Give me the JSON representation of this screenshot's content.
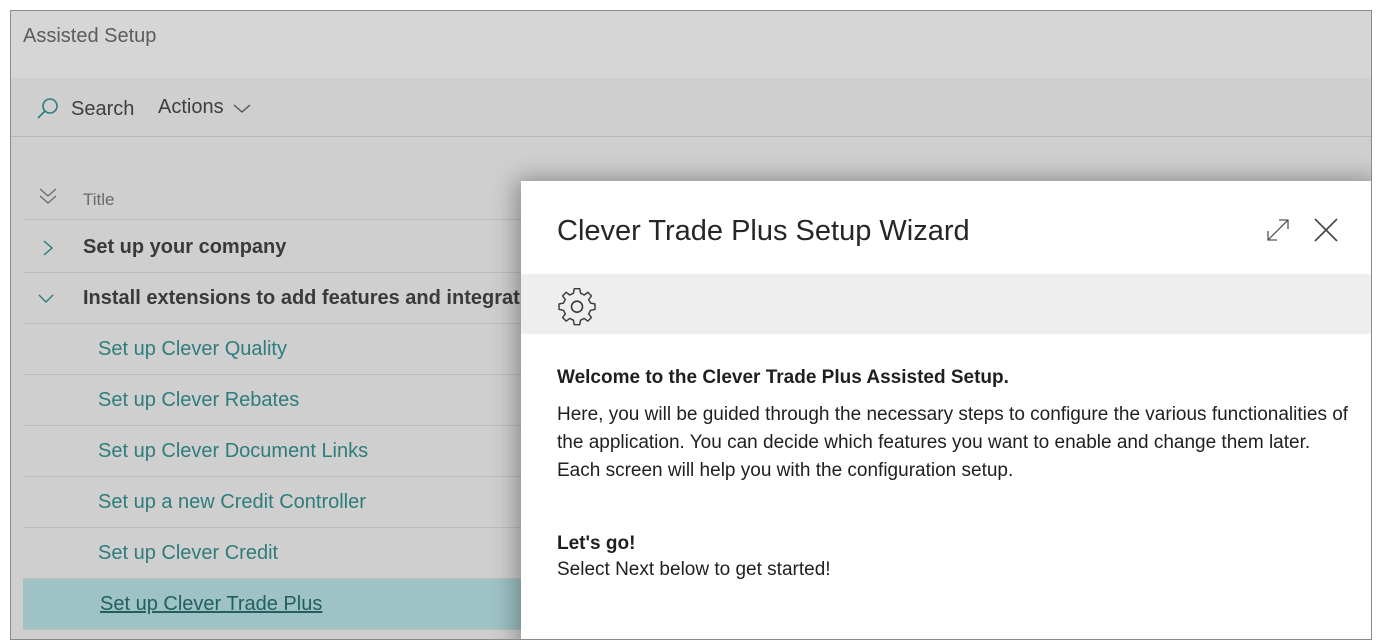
{
  "page": {
    "title": "Assisted Setup"
  },
  "action_bar": {
    "search_label": "Search",
    "actions_label": "Actions"
  },
  "list": {
    "column_title": "Title",
    "groups": [
      {
        "label": "Set up your company",
        "expanded": false
      },
      {
        "label": "Install extensions to add features and integrations",
        "expanded": true
      }
    ],
    "items": [
      {
        "label": "Set up Clever Quality"
      },
      {
        "label": "Set up Clever Rebates"
      },
      {
        "label": "Set up Clever Document Links"
      },
      {
        "label": "Set up a new Credit Controller"
      },
      {
        "label": "Set up Clever Credit"
      },
      {
        "label": "Set up Clever Trade Plus",
        "selected": true
      }
    ]
  },
  "dialog": {
    "title": "Clever Trade Plus Setup Wizard",
    "icon": "gear-icon",
    "welcome_heading": "Welcome to the Clever Trade Plus Assisted Setup.",
    "intro_text": "Here, you will be guided through the necessary steps to configure the various functionalities of the application. You can decide which features you want to enable and change them later. Each screen will help you with the configuration setup.",
    "lets_go_heading": "Let's go!",
    "next_hint": "Select Next below to get started!"
  },
  "colors": {
    "link": "#2e7c7c",
    "selected_row": "#9fc3c5",
    "dimmed_background": "#cfcfcf"
  }
}
